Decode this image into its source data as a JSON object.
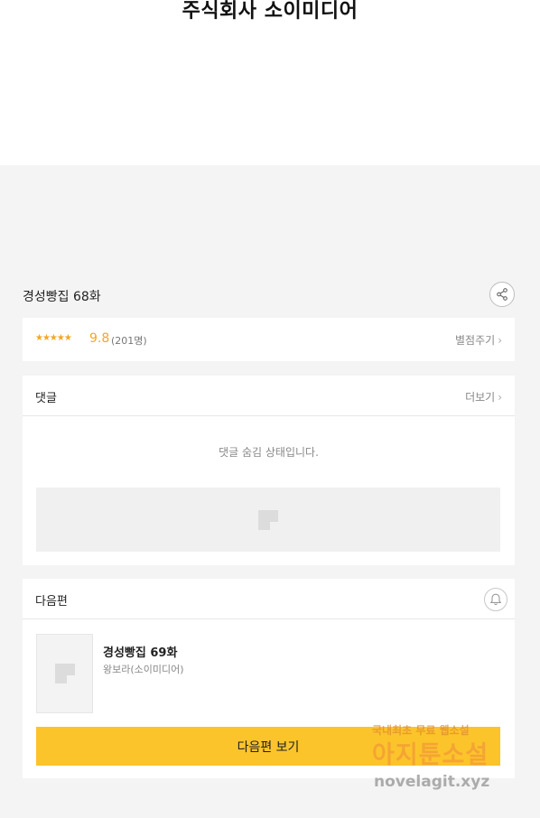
{
  "header": {
    "company": "주식회사 소이미디어"
  },
  "episode": {
    "title": "경성빵집 68화"
  },
  "rating": {
    "stars": "★★★★★",
    "score": "9.8",
    "count": "(201명)",
    "rate_label": "별점주기"
  },
  "comments": {
    "label": "댓글",
    "more_label": "더보기",
    "hidden_message": "댓글 숨김 상태입니다."
  },
  "next": {
    "label": "다음편",
    "title": "경성빵집 69화",
    "author": "왕보라(소이미디어)",
    "button_label": "다음편 보기"
  },
  "watermark": {
    "line1": "국내최초 무료 웹소설",
    "line2": "아지툰소설",
    "line3": "novelagit.xyz"
  },
  "colors": {
    "accent": "#fcc42b",
    "rating": "#f5a623"
  },
  "icons": {
    "share": "share-icon",
    "bell": "bell-icon",
    "placeholder": "image-placeholder-icon"
  }
}
